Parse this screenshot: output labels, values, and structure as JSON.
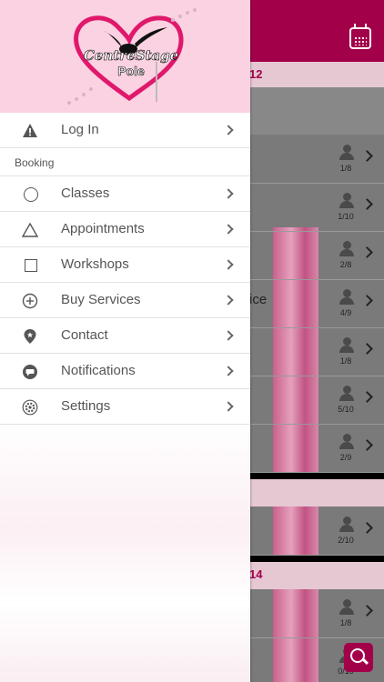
{
  "app": {
    "logo": {
      "line1": "CentreStage",
      "line2": "Pole"
    },
    "colors": {
      "brand": "#a3004a",
      "drawer_header": "#fbd2e1",
      "section_date": "#e6c8d3"
    }
  },
  "menu": {
    "login": {
      "label": "Log In",
      "icon": "warning-icon"
    },
    "section_label": "Booking",
    "items": [
      {
        "label": "Classes",
        "icon": "circle-icon"
      },
      {
        "label": "Appointments",
        "icon": "triangle-icon"
      },
      {
        "label": "Workshops",
        "icon": "square-icon"
      },
      {
        "label": "Buy Services",
        "icon": "plus-circle-icon"
      },
      {
        "label": "Contact",
        "icon": "location-pin-icon"
      },
      {
        "label": "Notifications",
        "icon": "chat-bubble-icon"
      },
      {
        "label": "Settings",
        "icon": "gear-icon"
      }
    ]
  },
  "background": {
    "date_headers": [
      "12",
      "",
      "14"
    ],
    "counts": [
      "1/8",
      "1/10",
      "2/8",
      "4/9",
      "1/8",
      "5/10",
      "2/9",
      "2/10",
      "1/8",
      "0/10"
    ],
    "fragment_text": "ice"
  }
}
